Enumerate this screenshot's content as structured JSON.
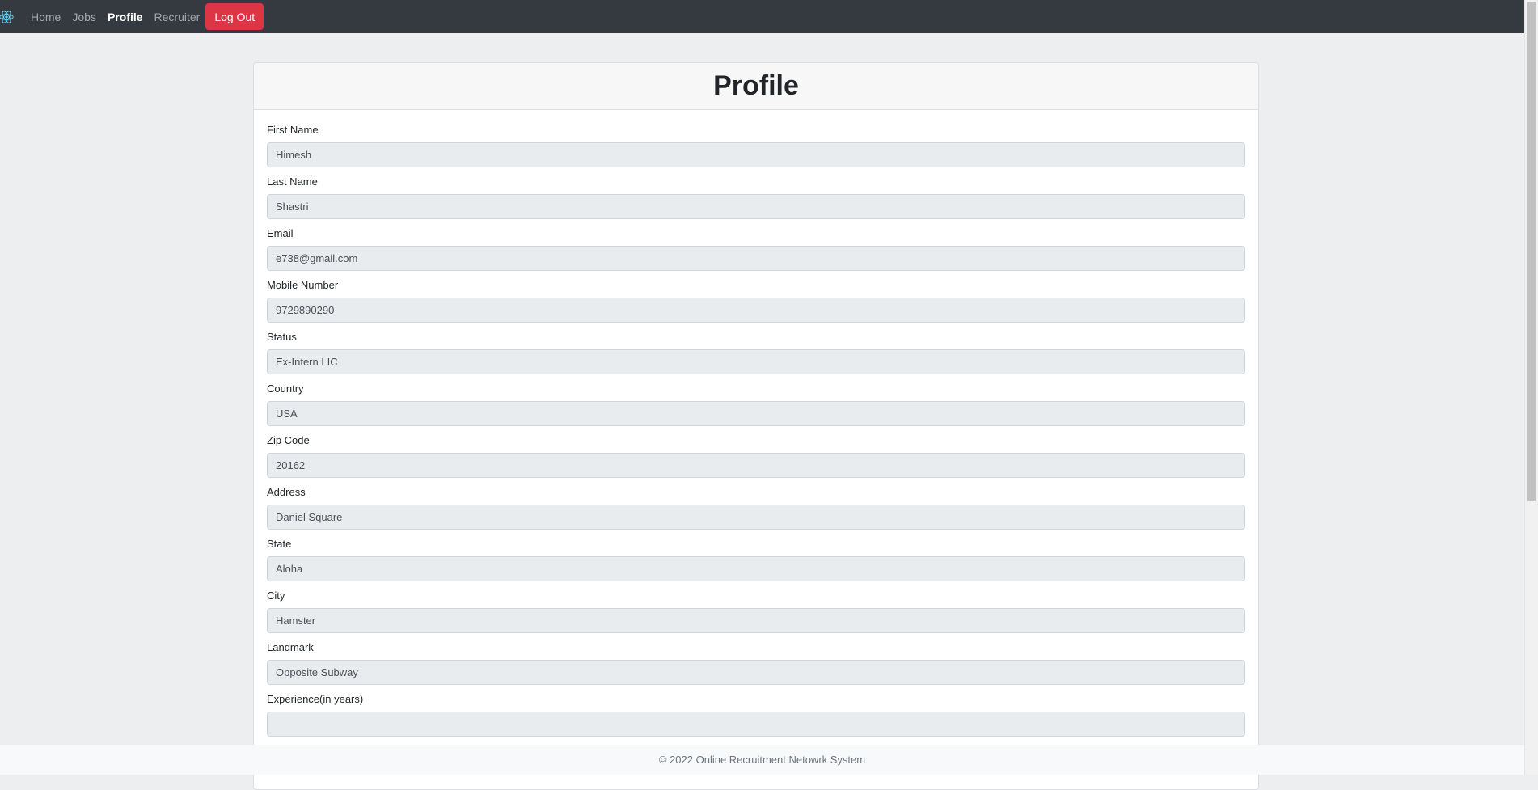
{
  "navbar": {
    "brand_icon": "react-logo-icon",
    "links": [
      {
        "label": "Home",
        "active": false
      },
      {
        "label": "Jobs",
        "active": false
      },
      {
        "label": "Profile",
        "active": true
      },
      {
        "label": "Recruiter",
        "active": false
      }
    ],
    "logout_label": "Log Out",
    "logout_color": "#dc3545"
  },
  "profile": {
    "title": "Profile",
    "fields": [
      {
        "label": "First Name",
        "value": "Himesh"
      },
      {
        "label": "Last Name",
        "value": "Shastri"
      },
      {
        "label": "Email",
        "value": "e738@gmail.com"
      },
      {
        "label": "Mobile Number",
        "value": "9729890290"
      },
      {
        "label": "Status",
        "value": "Ex-Intern LIC"
      },
      {
        "label": "Country",
        "value": "USA"
      },
      {
        "label": "Zip Code",
        "value": "20162"
      },
      {
        "label": "Address",
        "value": "Daniel Square"
      },
      {
        "label": "State",
        "value": "Aloha"
      },
      {
        "label": "City",
        "value": "Hamster"
      },
      {
        "label": "Landmark",
        "value": "Opposite Subway"
      },
      {
        "label": "Experience(in years)",
        "value": ""
      }
    ]
  },
  "footer": {
    "text": "© 2022 Online Recruitment Netowrk System"
  }
}
